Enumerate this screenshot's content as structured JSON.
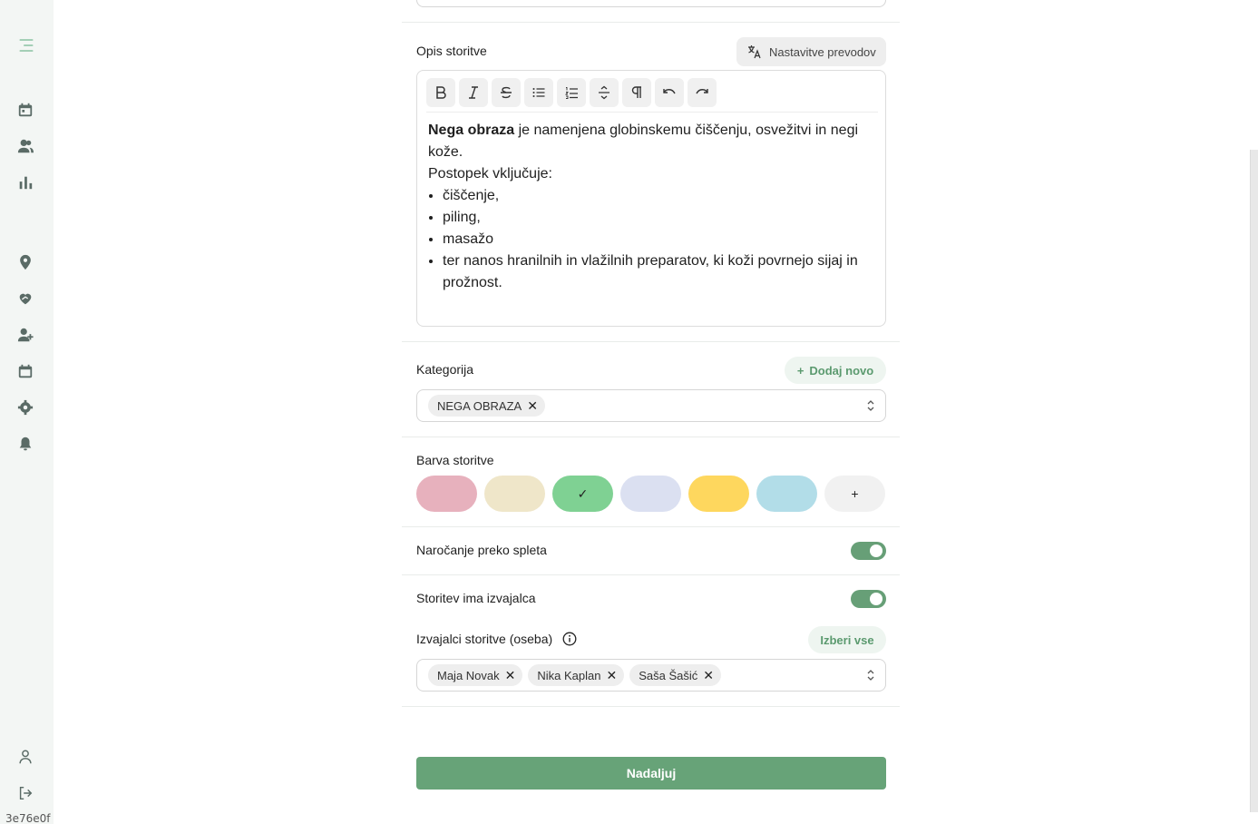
{
  "sidebar": {
    "icons": [
      "menu-icon",
      "calendar-icon",
      "users-icon",
      "bar-chart-icon",
      "location-icon",
      "heart-hand-icon",
      "user-add-icon",
      "calendar-schedule-icon",
      "gear-icon",
      "bell-icon",
      "profile-icon",
      "logout-icon"
    ],
    "build_hash": "3e76e0f"
  },
  "description": {
    "label": "Opis storitve",
    "translate_button": "Nastavitve prevodov",
    "toolbar": [
      "bold",
      "italic",
      "strikethrough",
      "bullet-list",
      "ordered-list",
      "horizontal-rule",
      "paragraph",
      "undo",
      "redo"
    ],
    "intro_bold": "Nega obraza",
    "intro_rest": " je namenjena globinskemu čiščenju, osvežitvi in negi kože.",
    "line2": "Postopek vključuje:",
    "items": [
      "čiščenje,",
      "piling,",
      "masažo",
      "ter nanos hranilnih in vlažilnih preparatov, ki koži povrnejo sijaj in prožnost."
    ]
  },
  "category": {
    "label": "Kategorija",
    "add_button": "Dodaj novo",
    "selected": [
      "NEGA OBRAZA"
    ]
  },
  "color": {
    "label": "Barva storitve",
    "swatches": [
      "#e7b1bd",
      "#efe6c9",
      "#7fd193",
      "#dbe0f1",
      "#fed75e",
      "#b2dde8",
      "#f1f1f1"
    ],
    "selected_mark": "✓",
    "add_mark": "+"
  },
  "online_booking": {
    "label": "Naročanje preko spleta",
    "enabled": true
  },
  "has_provider": {
    "label": "Storitev ima izvajalca",
    "enabled": true
  },
  "providers": {
    "label": "Izvajalci storitve (oseba)",
    "select_all": "Izberi vse",
    "selected": [
      "Maja Novak",
      "Nika Kaplan",
      "Saša Šašić"
    ]
  },
  "continue_button": "Nadaljuj",
  "colors": {
    "primary": "#67a378",
    "soft_button_bg": "#eef5f0",
    "sidebar_bg": "#f3f6f4"
  }
}
